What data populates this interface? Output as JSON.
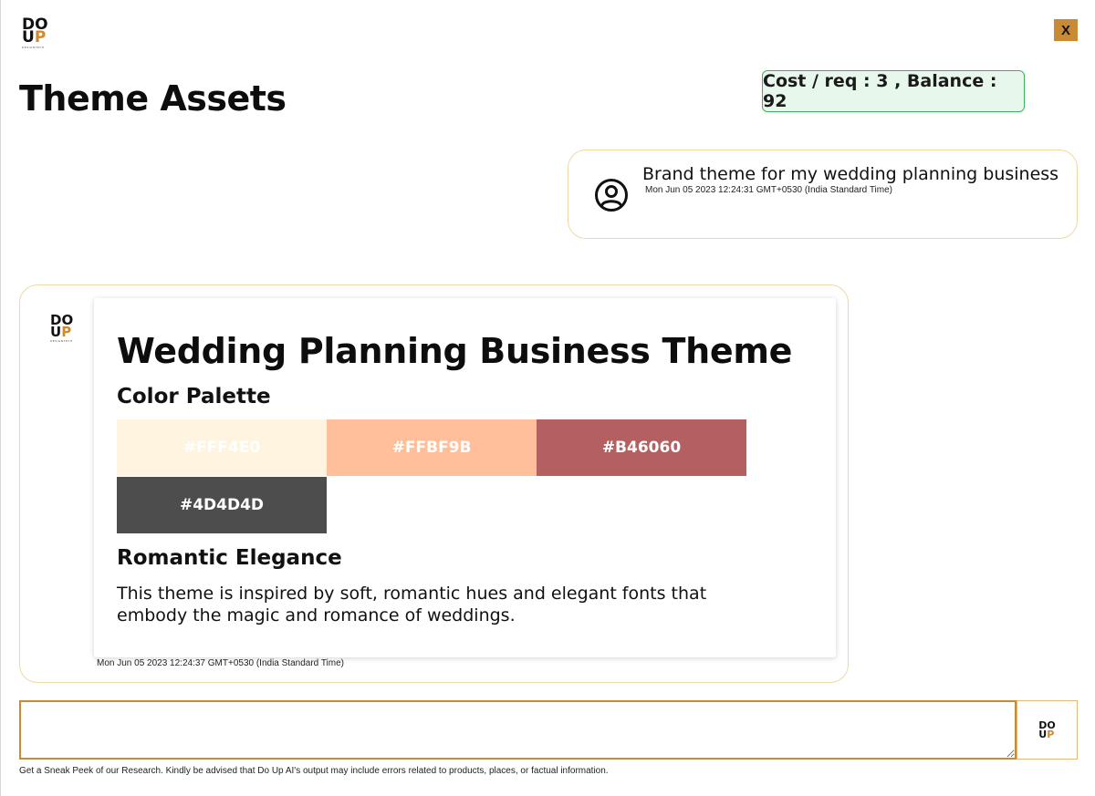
{
  "header": {
    "logo": {
      "line1": "DO",
      "line2_u": "U",
      "line2_p": "P",
      "tagline": "DESIGNTECH"
    },
    "close_label": "X",
    "title": "Theme Assets",
    "cost_badge": "Cost / req : 3 , Balance : 92"
  },
  "user_message": {
    "avatar_icon": "user-circle-icon",
    "text": "Brand theme for my wedding planning business",
    "timestamp": "Mon Jun 05 2023 12:24:31 GMT+0530 (India Standard Time)"
  },
  "bot_message": {
    "title": "Wedding Planning Business Theme",
    "palette_heading": "Color Palette",
    "palette": [
      {
        "hex": "#FFF4E0",
        "label": "#FFF4E0"
      },
      {
        "hex": "#FFBF9B",
        "label": "#FFBF9B"
      },
      {
        "hex": "#B46060",
        "label": "#B46060"
      },
      {
        "hex": "#4D4D4D",
        "label": "#4D4D4D"
      }
    ],
    "theme_name": "Romantic Elegance",
    "description": "This theme is inspired by soft, romantic hues and elegant fonts that embody the magic and romance of weddings.",
    "timestamp": "Mon Jun 05 2023 12:24:37 GMT+0530 (India Standard Time)"
  },
  "composer": {
    "placeholder": "",
    "send_icon": "doup-logo-icon"
  },
  "disclaimer": "Get a Sneak Peek of our Research. Kindly be advised that Do Up AI's output may include errors related to products, places, or factual information.",
  "colors": {
    "accent": "#C98A36",
    "border_light": "#F1D7A4",
    "badge_border": "#3CB35A",
    "badge_bg": "#E8F7EC"
  }
}
